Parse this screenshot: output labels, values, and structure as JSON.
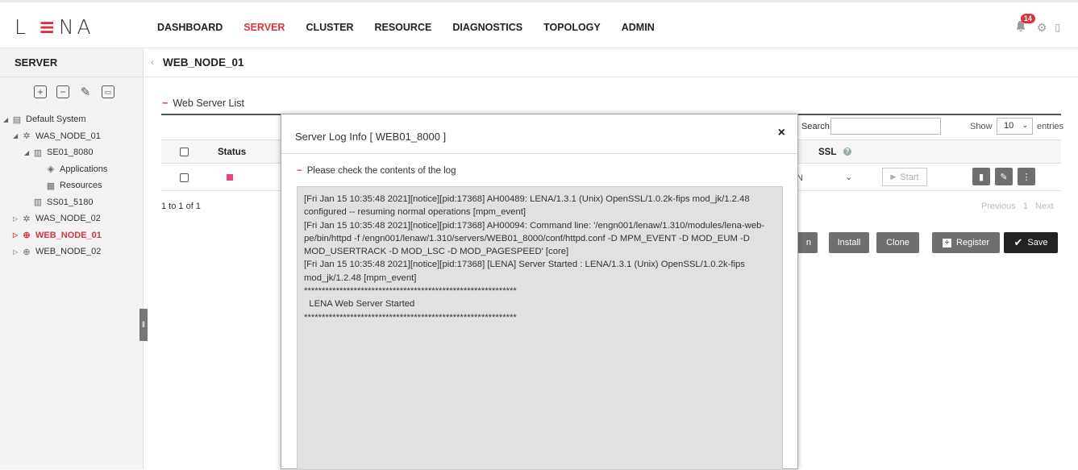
{
  "logo": {
    "letters_left": "L",
    "bars": "≡",
    "letters_right": "NA"
  },
  "nav": {
    "items": [
      "DASHBOARD",
      "SERVER",
      "CLUSTER",
      "RESOURCE",
      "DIAGNOSTICS",
      "TOPOLOGY",
      "ADMIN"
    ],
    "active": "SERVER"
  },
  "notifications": {
    "count": "14"
  },
  "sidebar": {
    "title": "SERVER",
    "tree": [
      {
        "label": "Default System",
        "icon": "system-icon"
      },
      {
        "label": "WAS_NODE_01",
        "icon": "node-icon"
      },
      {
        "label": "SE01_8080",
        "icon": "server-icon"
      },
      {
        "label": "Applications",
        "icon": "application-icon"
      },
      {
        "label": "Resources",
        "icon": "resource-icon"
      },
      {
        "label": "SS01_5180",
        "icon": "server-icon"
      },
      {
        "label": "WAS_NODE_02",
        "icon": "node-icon"
      },
      {
        "label": "WEB_NODE_01",
        "icon": "globe-icon"
      },
      {
        "label": "WEB_NODE_02",
        "icon": "globe-icon"
      }
    ]
  },
  "page": {
    "title": "WEB_NODE_01",
    "section": "Web Server List"
  },
  "table": {
    "search_label": "Search",
    "show_label": "Show",
    "page_size": "10",
    "entries_label": "entries",
    "col_status": "Status",
    "col_ssl": "SSL",
    "ssl_value": "N",
    "start_label": "Start",
    "info": "1 to 1 of 1",
    "prev": "Previous",
    "page": "1",
    "next": "Next"
  },
  "actions": {
    "partial": "n",
    "install": "Install",
    "clone": "Clone",
    "register": "Register",
    "save": "Save"
  },
  "modal": {
    "title": "Server Log Info [ WEB01_8000 ]",
    "close": "×",
    "note": "Please check the contents of the log",
    "log": "[Fri Jan 15 10:35:48 2021][notice][pid:17368] AH00489: LENA/1.3.1 (Unix) OpenSSL/1.0.2k-fips mod_jk/1.2.48\nconfigured -- resuming normal operations [mpm_event]\n[Fri Jan 15 10:35:48 2021][notice][pid:17368] AH00094: Command line: '/engn001/lenaw/1.310/modules/lena-web-\npe/bin/httpd -f /engn001/lenaw/1.310/servers/WEB01_8000/conf/httpd.conf -D MPM_EVENT -D MOD_EUM -D\nMOD_USERTRACK -D MOD_LSC -D MOD_PAGESPEED' [core]\n[Fri Jan 15 10:35:48 2021][notice][pid:17368] [LENA] Server Started : LENA/1.3.1 (Unix) OpenSSL/1.0.2k-fips\nmod_jk/1.2.48 [mpm_event]\n************************************************************\n  LENA Web Server Started\n************************************************************"
  }
}
